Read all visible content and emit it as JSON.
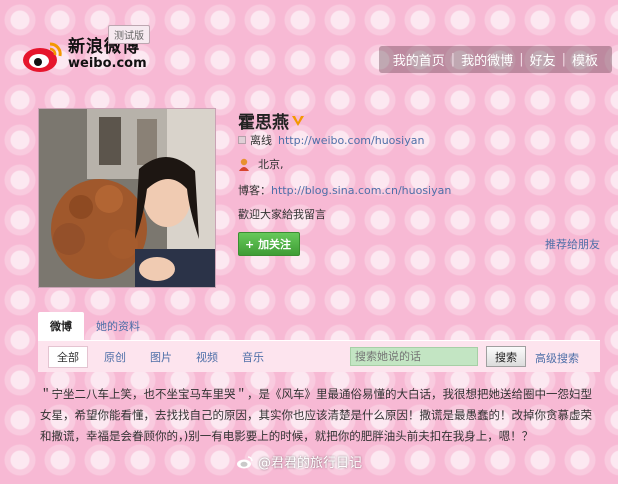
{
  "header": {
    "logo_cn": "新浪微博",
    "logo_en": "weibo.com",
    "beta_badge": "测试版",
    "nav": [
      "我的首页",
      "我的微博",
      "好友",
      "模板"
    ],
    "nav_sep": "|"
  },
  "profile": {
    "name": "霍思燕",
    "status": "离线",
    "weibo_url": "http://weibo.com/huosiyan",
    "location": "北京,",
    "blog_label": "博客：",
    "blog_url": "http://blog.sina.com.cn/huosiyan",
    "bio": "歡迎大家給我留言",
    "follow_button": "加关注",
    "follow_plus": "+",
    "recommend_link": "推荐给朋友"
  },
  "tabs": [
    "微博",
    "她的资料"
  ],
  "filters": [
    "全部",
    "原创",
    "图片",
    "视频",
    "音乐"
  ],
  "search": {
    "placeholder": "搜索她说的话",
    "button": "搜索",
    "advanced": "高级搜索"
  },
  "post": {
    "text": "＂宁坐二八车上笑，也不坐宝马车里哭＂，是《风车》里最通俗易懂的大白话，我很想把她送给圈中一怨妇型女星，希望你能看懂，去找找自己的原因，其实你也应该清楚是什么原因！撒谎是最愚蠢的！改掉你贪慕虚荣和撒谎，幸福是会眷顾你的，)别一有电影要上的时候，就把你的肥胖油头前夫扣在我身上，嗯！？"
  },
  "watermark": "@君君的旅行日记",
  "colors": {
    "background": "#f7b9d4",
    "link": "#4e6fa8",
    "follow_green": "#4faa43"
  }
}
